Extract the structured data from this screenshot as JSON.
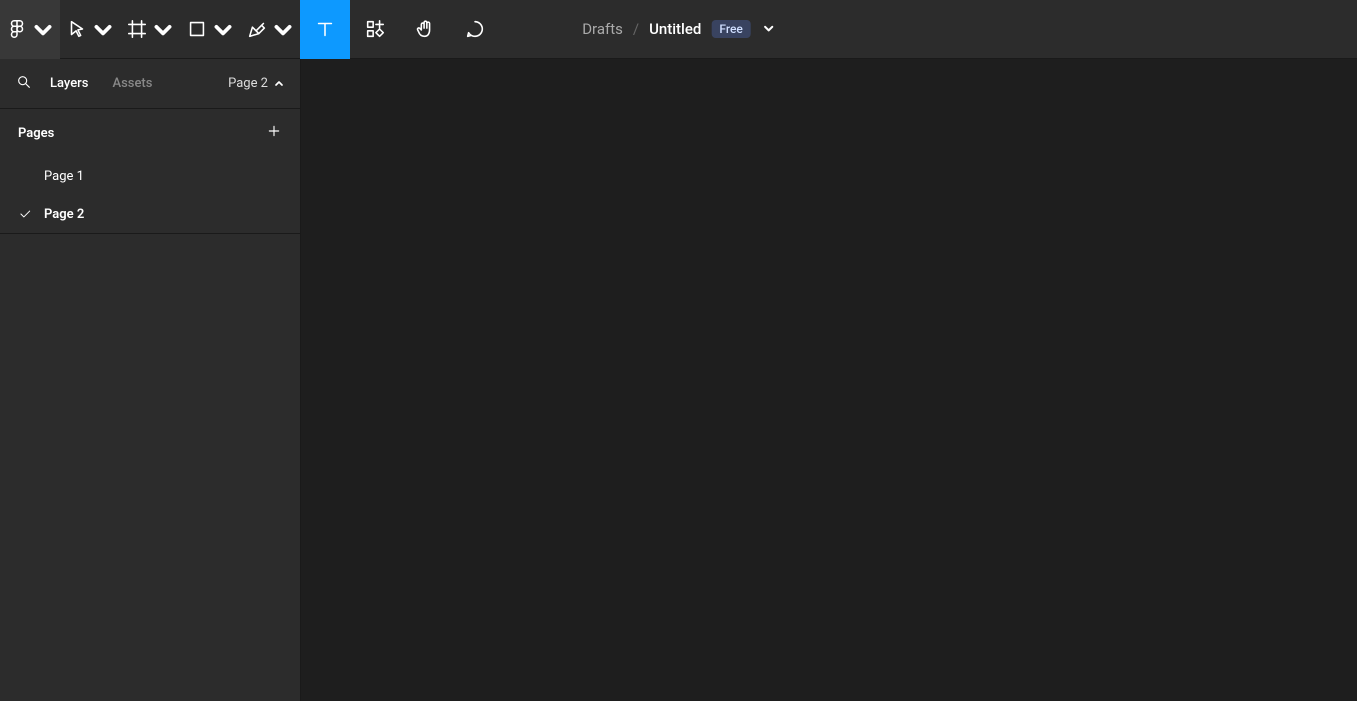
{
  "toolbar": {
    "tools": {
      "menu": "Main menu",
      "move": "Move",
      "frame": "Frame",
      "shape": "Rectangle",
      "pen": "Pen",
      "text": "Text",
      "resources": "Resources",
      "hand": "Hand",
      "comment": "Comment"
    }
  },
  "breadcrumb": {
    "folder": "Drafts",
    "separator": "/",
    "title": "Untitled",
    "plan_badge": "Free"
  },
  "sidebar": {
    "tabs": {
      "layers": "Layers",
      "assets": "Assets"
    },
    "page_selector": "Page 2",
    "pages_header": "Pages",
    "pages": [
      {
        "label": "Page 1",
        "selected": false
      },
      {
        "label": "Page 2",
        "selected": true
      }
    ]
  }
}
